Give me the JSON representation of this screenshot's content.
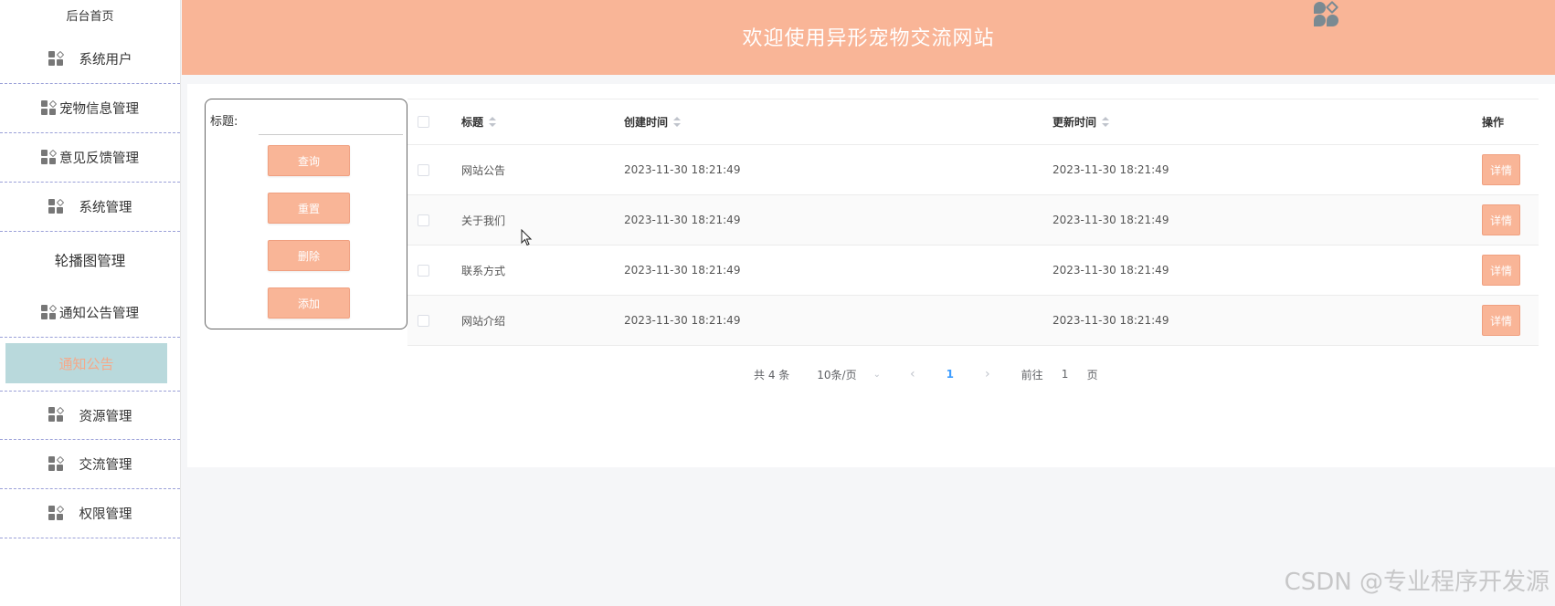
{
  "sidebar": {
    "home": "后台首页",
    "items": [
      {
        "label": "系统用户",
        "icon": "grid-icon"
      },
      {
        "label": "宠物信息管理",
        "icon": "grid-icon"
      },
      {
        "label": "意见反馈管理",
        "icon": "grid-icon"
      },
      {
        "label": "系统管理",
        "icon": "grid-icon"
      },
      {
        "label": "轮播图管理"
      },
      {
        "label": "通知公告管理",
        "icon": "grid-icon"
      },
      {
        "label": "资源管理",
        "icon": "grid-icon"
      },
      {
        "label": "交流管理",
        "icon": "grid-icon"
      },
      {
        "label": "权限管理",
        "icon": "grid-icon"
      }
    ],
    "active_sub": "通知公告"
  },
  "header": {
    "title": "欢迎使用异形宠物交流网站"
  },
  "search": {
    "label": "标题:",
    "value": "",
    "buttons": {
      "query": "查询",
      "reset": "重置",
      "delete": "删除",
      "add": "添加"
    }
  },
  "table": {
    "headers": {
      "title": "标题",
      "created": "创建时间",
      "updated": "更新时间",
      "op": "操作"
    },
    "rows": [
      {
        "title": "网站公告",
        "created": "2023-11-30 18:21:49",
        "updated": "2023-11-30 18:21:49",
        "action": "详情"
      },
      {
        "title": "关于我们",
        "created": "2023-11-30 18:21:49",
        "updated": "2023-11-30 18:21:49",
        "action": "详情"
      },
      {
        "title": "联系方式",
        "created": "2023-11-30 18:21:49",
        "updated": "2023-11-30 18:21:49",
        "action": "详情"
      },
      {
        "title": "网站介绍",
        "created": "2023-11-30 18:21:49",
        "updated": "2023-11-30 18:21:49",
        "action": "详情"
      }
    ]
  },
  "pagination": {
    "total": "共 4 条",
    "page_size": "10条/页",
    "current": "1",
    "goto_label": "前往",
    "goto_value": "1",
    "page_unit": "页"
  },
  "watermark": "CSDN @专业程序开发源",
  "colors": {
    "accent": "#f9b597",
    "active_bg": "#b9d9dc",
    "page_link": "#409eff"
  }
}
